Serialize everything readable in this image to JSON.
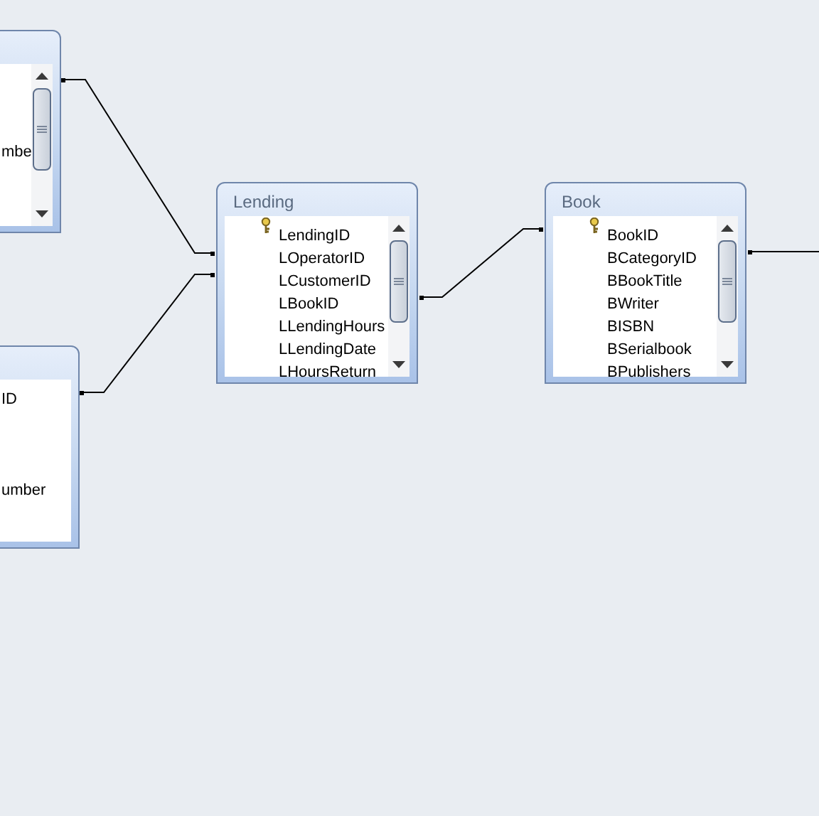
{
  "tables": [
    {
      "fields": [
        {
          "name": "mbe",
          "primary_key": false
        }
      ],
      "scrollbar": true
    },
    {
      "fields": [
        {
          "name": "ID",
          "primary_key": false
        },
        {
          "name": "umber",
          "primary_key": false
        }
      ],
      "scrollbar": false
    },
    {
      "title": "Lending",
      "fields": [
        {
          "name": "LendingID",
          "primary_key": true
        },
        {
          "name": "LOperatorID",
          "primary_key": false
        },
        {
          "name": "LCustomerID",
          "primary_key": false
        },
        {
          "name": "LBookID",
          "primary_key": false
        },
        {
          "name": "LLendingHours",
          "primary_key": false
        },
        {
          "name": "LLendingDate",
          "primary_key": false
        },
        {
          "name": "LHoursReturn",
          "primary_key": false
        }
      ],
      "scrollbar": true
    },
    {
      "title": "Book",
      "fields": [
        {
          "name": "BookID",
          "primary_key": true
        },
        {
          "name": "BCategoryID",
          "primary_key": false
        },
        {
          "name": "BBookTitle",
          "primary_key": false
        },
        {
          "name": "BWriter",
          "primary_key": false
        },
        {
          "name": "BISBN",
          "primary_key": false
        },
        {
          "name": "BSerialbook",
          "primary_key": false
        },
        {
          "name": "BPublishers",
          "primary_key": false
        }
      ],
      "scrollbar": true
    }
  ]
}
